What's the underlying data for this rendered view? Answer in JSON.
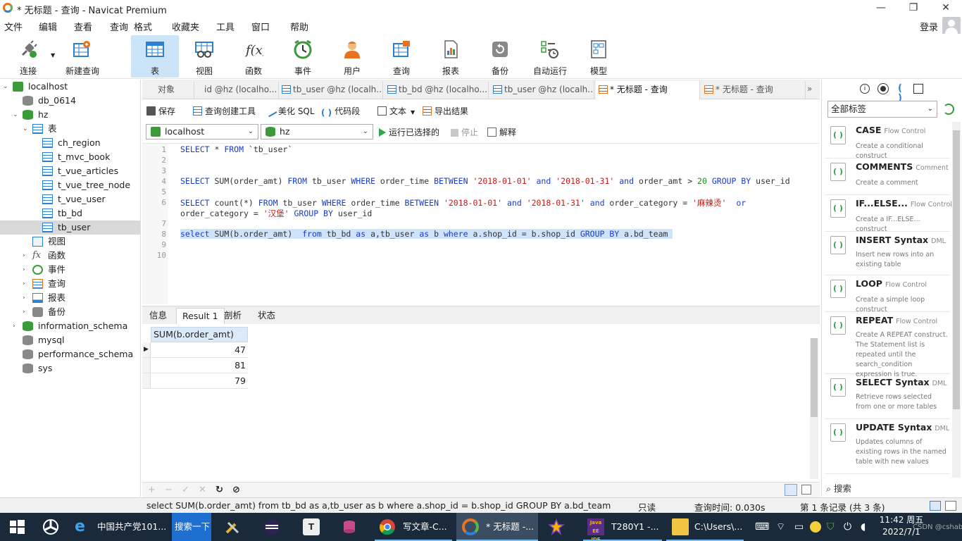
{
  "window": {
    "title": "* 无标题 - 查询 - Navicat Premium",
    "controls": [
      "—",
      "❐",
      "✕"
    ]
  },
  "menubar": {
    "items": [
      "文件",
      "编辑",
      "查看",
      "查询",
      "格式",
      "收藏夹",
      "工具",
      "窗口",
      "帮助"
    ],
    "login": "登录"
  },
  "toolbar": {
    "items": [
      {
        "label": "连接",
        "icon": "plug-icon"
      },
      {
        "label": "新建查询",
        "icon": "new-query-icon"
      },
      {
        "label": "表",
        "icon": "table-icon",
        "active": true
      },
      {
        "label": "视图",
        "icon": "view-icon"
      },
      {
        "label": "函数",
        "icon": "function-icon"
      },
      {
        "label": "事件",
        "icon": "clock-icon"
      },
      {
        "label": "用户",
        "icon": "user-icon"
      },
      {
        "label": "查询",
        "icon": "query-icon"
      },
      {
        "label": "报表",
        "icon": "report-icon"
      },
      {
        "label": "备份",
        "icon": "backup-icon"
      },
      {
        "label": "自动运行",
        "icon": "autorun-icon"
      },
      {
        "label": "模型",
        "icon": "model-icon"
      }
    ]
  },
  "tree": {
    "nodes": [
      {
        "label": "localhost",
        "icon": "server-icon",
        "twisty": "⌄"
      },
      {
        "label": "db_0614",
        "icon": "database-gray-icon",
        "twisty": ""
      },
      {
        "label": "hz",
        "icon": "database-icon",
        "twisty": "⌄"
      },
      {
        "label": "表",
        "icon": "table-group-icon",
        "twisty": "⌄"
      },
      {
        "label": "ch_region",
        "icon": "table-icon",
        "twisty": ""
      },
      {
        "label": "t_mvc_book",
        "icon": "table-icon",
        "twisty": ""
      },
      {
        "label": "t_vue_articles",
        "icon": "table-icon",
        "twisty": ""
      },
      {
        "label": "t_vue_tree_node",
        "icon": "table-icon",
        "twisty": ""
      },
      {
        "label": "t_vue_user",
        "icon": "table-icon",
        "twisty": ""
      },
      {
        "label": "tb_bd",
        "icon": "table-icon",
        "twisty": ""
      },
      {
        "label": "tb_user",
        "icon": "table-icon",
        "twisty": "",
        "selected": true
      },
      {
        "label": "视图",
        "icon": "view-icon",
        "twisty": ""
      },
      {
        "label": "函数",
        "icon": "function-icon",
        "twisty": "›"
      },
      {
        "label": "事件",
        "icon": "clock-icon",
        "twisty": "›"
      },
      {
        "label": "查询",
        "icon": "query-icon",
        "twisty": "›"
      },
      {
        "label": "报表",
        "icon": "report-icon",
        "twisty": "›"
      },
      {
        "label": "备份",
        "icon": "backup-icon",
        "twisty": "›"
      },
      {
        "label": "information_schema",
        "icon": "database-icon",
        "twisty": "›"
      },
      {
        "label": "mysql",
        "icon": "database-gray-icon",
        "twisty": ""
      },
      {
        "label": "performance_schema",
        "icon": "database-gray-icon",
        "twisty": ""
      },
      {
        "label": "sys",
        "icon": "database-gray-icon",
        "twisty": ""
      }
    ]
  },
  "tabs": {
    "objects_label": "对象",
    "items": [
      {
        "label": "id @hz (localho...",
        "active": false
      },
      {
        "label": "tb_user @hz (localh...",
        "active": false
      },
      {
        "label": "tb_bd @hz (localho...",
        "active": false
      },
      {
        "label": "tb_user @hz (localh...",
        "active": false
      },
      {
        "label": "* 无标题 - 查询",
        "active": true
      },
      {
        "label": "* 无标题 - 查询",
        "active": false
      }
    ],
    "more": "»"
  },
  "editor_toolbar": {
    "save": "保存",
    "query_builder": "查询创建工具",
    "beautify": "美化 SQL",
    "snippet": "代码段",
    "text": "文本",
    "export": "导出结果"
  },
  "connection_row": {
    "connection": "localhost",
    "database": "hz",
    "run": "运行已选择的",
    "stop": "停止",
    "explain": "解释"
  },
  "code": {
    "line_numbers": [
      "1",
      "2",
      "3",
      "4",
      "5",
      "6",
      "7",
      "8",
      "9",
      "10"
    ]
  },
  "results": {
    "tabs": [
      "信息",
      "Result 1",
      "剖析",
      "状态"
    ],
    "active_tab": "Result 1",
    "column": "SUM(b.order_amt)",
    "rows": [
      "47",
      "81",
      "79"
    ]
  },
  "grid_footer": {
    "buttons": [
      "+",
      "−",
      "✓",
      "✕",
      "↻",
      "⊘"
    ]
  },
  "right_panel": {
    "tag_filter": "全部标签",
    "snippets": [
      {
        "title": "CASE",
        "category": "Flow Control",
        "desc": "Create a conditional construct"
      },
      {
        "title": "COMMENTS",
        "category": "Comment",
        "desc": "Create a comment"
      },
      {
        "title": "IF...ELSE...",
        "category": "Flow Control",
        "desc": "Create a IF...ELSE... construct"
      },
      {
        "title": "INSERT Syntax",
        "category": "DML",
        "desc": "Insert new rows into an existing table"
      },
      {
        "title": "LOOP",
        "category": "Flow Control",
        "desc": "Create a simple loop construct"
      },
      {
        "title": "REPEAT",
        "category": "Flow Control",
        "desc": "Create A REPEAT construct. The Statement list is repeated until the search_condition expression is true."
      },
      {
        "title": "SELECT Syntax",
        "category": "DML",
        "desc": "Retrieve rows selected from one or more tables"
      },
      {
        "title": "UPDATE Syntax",
        "category": "DML",
        "desc": "Updates columns of existing rows in the named table with new values"
      }
    ],
    "search_label": "搜索"
  },
  "statusbar": {
    "sql": "select SUM(b.order_amt)  from tb_bd as a,tb_user as b where a.shop_id = b.shop_id GROUP BY a.bd_team",
    "readonly": "只读",
    "query_time": "查询时间: 0.030s",
    "record": "第 1 条记录 (共 3 条)"
  },
  "taskbar": {
    "items": [
      {
        "label": "中国共产党101...",
        "icon": "ie-icon"
      },
      {
        "label": "搜索一下",
        "icon": ""
      },
      {
        "label": "写文章-C...",
        "icon": "chrome-icon"
      },
      {
        "label": "* 无标题 -...",
        "icon": "navicat-icon"
      },
      {
        "label": "T280Y1 -...",
        "icon": "javaee-icon"
      },
      {
        "label": "C:\\Users\\...",
        "icon": "folder-icon"
      }
    ],
    "time": "11:42 周五",
    "date": "2022/7/1",
    "watermark": "CSDN @cshab"
  },
  "colors": {
    "accent": "#2d7fd1",
    "keyword": "#1a3bcc",
    "string": "#c41a16",
    "number": "#1a8a1a",
    "selection": "#cfe3fb",
    "taskbar": "#1b2a3a"
  }
}
